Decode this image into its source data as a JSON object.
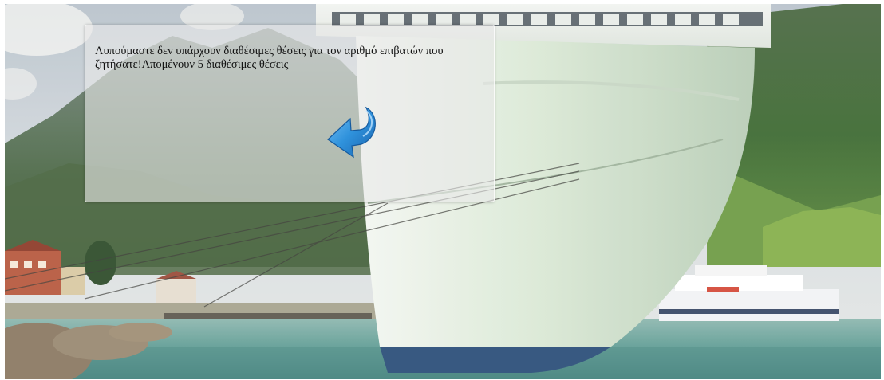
{
  "message": {
    "text": "Λυπούμαστε δεν υπάρχουν διαθέσιμες θέσεις για τον αριθμό επιβατών που ζητήσατε!Απομένουν 5 διαθέσιμες θέσεις"
  },
  "back_button": {
    "icon": "back-arrow-icon",
    "color": "#1f86d6"
  },
  "background": {
    "sky_color": "#c9d3dc",
    "water_color": "#6aa39f",
    "ship_hull_color": "#e3efe2"
  }
}
